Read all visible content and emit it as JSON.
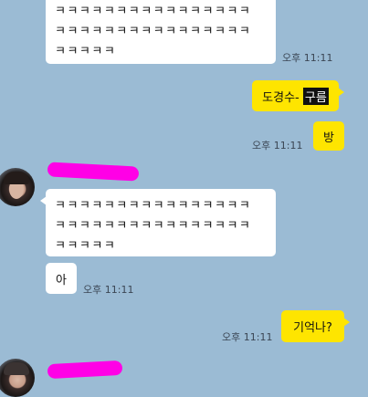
{
  "chat": {
    "messages": [
      {
        "lines": [
          "ㅋㅋㅋㅋㅋㅋㅋㅋㅋㅋㅋㅋㅋㅋㅋㅋ",
          "ㅋㅋㅋㅋㅋㅋㅋㅋㅋㅋㅋㅋㅋㅋㅋㅋ",
          "ㅋㅋㅋㅋㅋ"
        ],
        "time": "오후 11:11"
      },
      {
        "prefix": "도경수- ",
        "highlight": "구름",
        "time": ""
      },
      {
        "text": "방",
        "time": "오후 11:11"
      },
      {
        "lines": [
          "ㅋㅋㅋㅋㅋㅋㅋㅋㅋㅋㅋㅋㅋㅋㅋㅋ",
          "ㅋㅋㅋㅋㅋㅋㅋㅋㅋㅋㅋㅋㅋㅋㅋㅋ",
          "ㅋㅋㅋㅋㅋ"
        ],
        "time": ""
      },
      {
        "text": "아",
        "time": "오후 11:11"
      },
      {
        "text": "기억나?",
        "time": "오후 11:11"
      }
    ]
  },
  "colors": {
    "background": "#9bbbd4",
    "my_bubble": "#fee500",
    "their_bubble": "#ffffff",
    "redaction": "#ff00e6"
  }
}
